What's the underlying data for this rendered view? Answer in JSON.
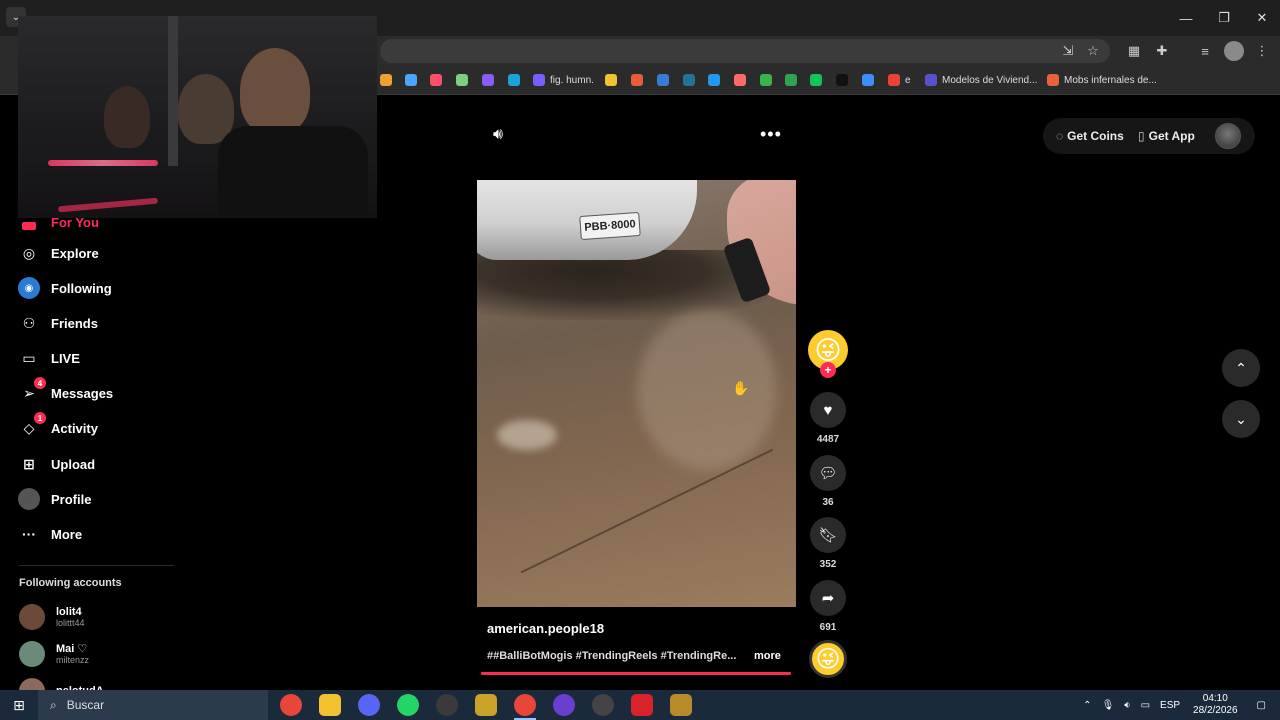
{
  "browser": {
    "bookmarks": [
      {
        "label": "",
        "color": "#f0a030"
      },
      {
        "label": "",
        "color": "#4aa3ff"
      },
      {
        "label": "",
        "color": "#ff4d6d"
      },
      {
        "label": "",
        "color": "#7bd07b"
      },
      {
        "label": "",
        "color": "#8a5cf6"
      },
      {
        "label": "",
        "color": "#1aa3d9"
      },
      {
        "label": "fig. humn.",
        "color": "#7b5cff"
      },
      {
        "label": "",
        "color": "#f2c230"
      },
      {
        "label": "",
        "color": "#e85c3a"
      },
      {
        "label": "",
        "color": "#3a7bd5"
      },
      {
        "label": "",
        "color": "#21759b"
      },
      {
        "label": "",
        "color": "#2196f3"
      },
      {
        "label": "",
        "color": "#ff6b6b"
      },
      {
        "label": "",
        "color": "#39b54a"
      },
      {
        "label": "",
        "color": "#2ea44f"
      },
      {
        "label": "",
        "color": "#14c25a"
      },
      {
        "label": "",
        "color": "#111111"
      },
      {
        "label": "",
        "color": "#3f8cff"
      },
      {
        "label": "e",
        "color": "#ea4335"
      },
      {
        "label": "Modelos de Viviend...",
        "color": "#5a4fcf"
      },
      {
        "label": "Mobs infernales de...",
        "color": "#e8623a"
      }
    ]
  },
  "sidebar": {
    "for_you": "For You",
    "items": [
      {
        "label": "Explore",
        "icon": "compass-icon",
        "glyph": "◎",
        "badge": ""
      },
      {
        "label": "Following",
        "icon": "following-icon",
        "glyph": "◉",
        "badge": ""
      },
      {
        "label": "Friends",
        "icon": "friends-icon",
        "glyph": "⚇",
        "badge": ""
      },
      {
        "label": "LIVE",
        "icon": "live-icon",
        "glyph": "▭",
        "badge": ""
      },
      {
        "label": "Messages",
        "icon": "messages-icon",
        "glyph": "➢",
        "badge": "4"
      },
      {
        "label": "Activity",
        "icon": "activity-icon",
        "glyph": "◇",
        "badge": "1"
      },
      {
        "label": "Upload",
        "icon": "upload-icon",
        "glyph": "⊞",
        "badge": ""
      },
      {
        "label": "Profile",
        "icon": "profile-icon",
        "glyph": "●",
        "badge": ""
      },
      {
        "label": "More",
        "icon": "more-icon",
        "glyph": "···",
        "badge": ""
      }
    ],
    "following_title": "Following accounts",
    "accounts": [
      {
        "name": "lolit4",
        "handle": "lolittt44",
        "color": "#6b4a3a"
      },
      {
        "name": "Mai ♡",
        "handle": "miltenzz",
        "color": "#6a8a7a"
      },
      {
        "name": "pelotudA",
        "handle": "",
        "color": "#8a6a5a"
      }
    ]
  },
  "header": {
    "get_coins": "Get Coins",
    "get_app": "Get App"
  },
  "video": {
    "plate_text": "PBB·8000",
    "author": "american.people18",
    "description": "##BalliBotMogis #TrendingReels #TrendingRe...",
    "more": "more",
    "progress": 1.0
  },
  "actions": {
    "likes": "4487",
    "comments": "36",
    "saves": "352",
    "shares": "691"
  },
  "taskbar": {
    "search_placeholder": "Buscar",
    "lang": "ESP",
    "time": "04:10",
    "date": "28/2/2026"
  }
}
